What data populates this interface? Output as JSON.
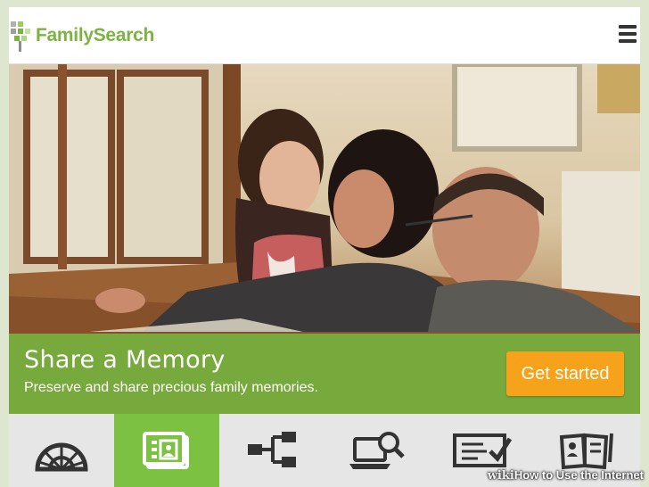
{
  "header": {
    "brand": "FamilySearch",
    "logo_icon": "family-tree-logo-icon",
    "menu_icon": "hamburger-menu-icon"
  },
  "hero": {
    "title": "Share a Memory",
    "subtitle": "Preserve and share precious family memories.",
    "cta_label": "Get started"
  },
  "tiles": [
    {
      "icon": "fan-chart-icon",
      "active": false
    },
    {
      "icon": "photo-memories-icon",
      "active": true
    },
    {
      "icon": "family-tree-icon",
      "active": false
    },
    {
      "icon": "search-records-icon",
      "active": false
    },
    {
      "icon": "indexing-icon",
      "active": false
    },
    {
      "icon": "learning-center-icon",
      "active": false
    }
  ],
  "watermark": {
    "prefix": "wiki",
    "text": "How to Use the Internet"
  },
  "colors": {
    "brand_green": "#7cb342",
    "banner_green": "#76b23e",
    "cta_orange": "#f7a21b",
    "active_tile": "#7dc142"
  }
}
